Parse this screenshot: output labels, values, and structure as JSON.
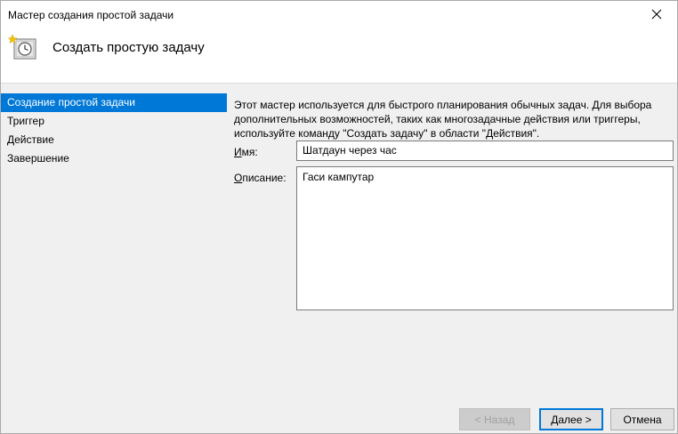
{
  "window": {
    "title": "Мастер создания простой задачи"
  },
  "header": {
    "title": "Создать простую задачу"
  },
  "sidebar": {
    "steps": [
      {
        "label": "Создание простой задачи"
      },
      {
        "label": "Триггер"
      },
      {
        "label": "Действие"
      },
      {
        "label": "Завершение"
      }
    ],
    "active_index": 0
  },
  "main": {
    "intro_lines": [
      "Этот мастер используется для быстрого планирования обычных задач.  Для выбора",
      "дополнительных возможностей, таких как многозадачные действия или триггеры,",
      "используйте команду \"Создать задачу\" в области \"Действия\"."
    ],
    "name_label_mnemonic": "И",
    "name_label_rest": "мя:",
    "name_value": "Шатдаун через час",
    "description_label_mnemonic": "О",
    "description_label_rest": "писание:",
    "description_value": "Гаси кампутар"
  },
  "buttons": {
    "back": "< Назад",
    "next": "Далее >",
    "cancel": "Отмена"
  },
  "colors": {
    "accent": "#0078d7",
    "background": "#f0f0f0"
  }
}
